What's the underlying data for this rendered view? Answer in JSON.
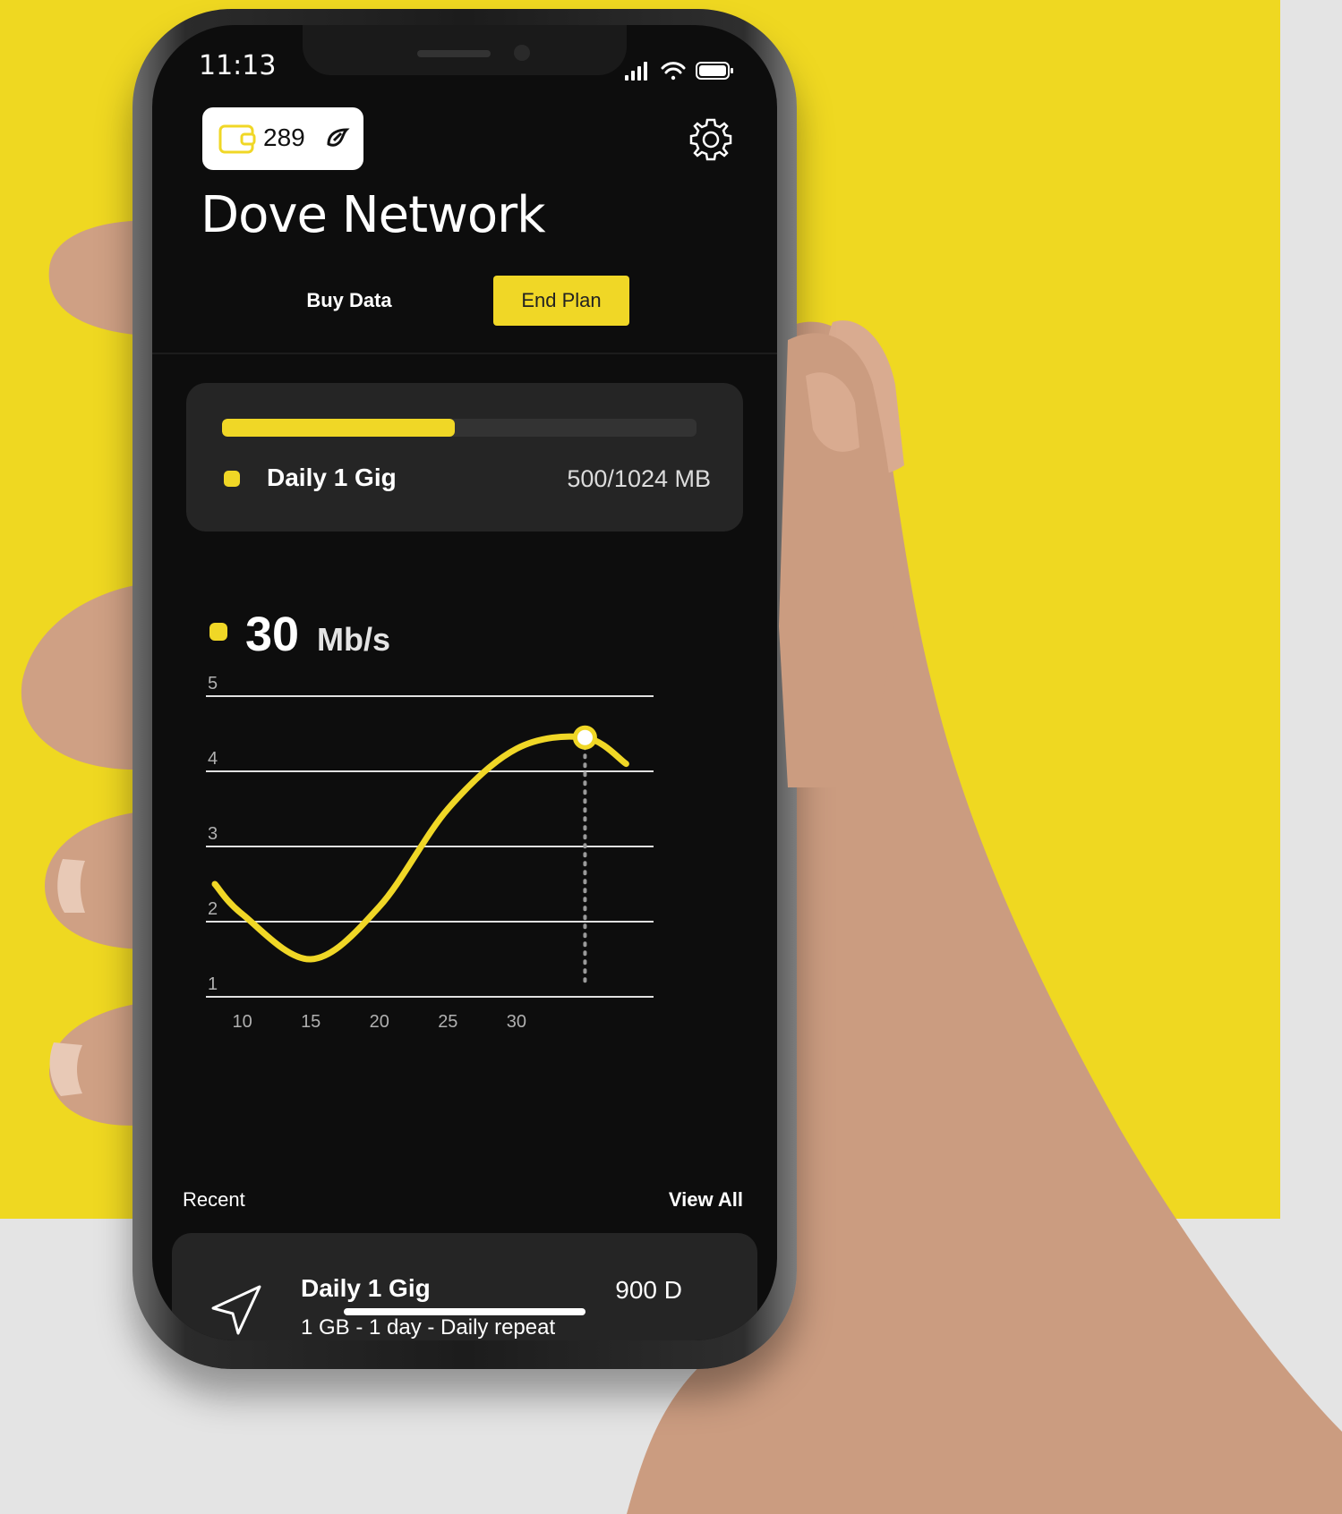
{
  "status_bar": {
    "time": "11:13"
  },
  "wallet": {
    "amount": "289",
    "icon": "wallet-icon",
    "currency_icon": "dove-currency-icon"
  },
  "settings": {
    "icon": "gear-icon"
  },
  "title": "Dove Network",
  "actions": {
    "buy_data": "Buy Data",
    "end_plan": "End Plan"
  },
  "plan": {
    "name": "Daily 1 Gig",
    "usage": "500/1024 MB",
    "progress": 0.49
  },
  "speed": {
    "value": "30",
    "unit": "Mb/s"
  },
  "chart_data": {
    "type": "line",
    "x_ticks": [
      "10",
      "15",
      "20",
      "25",
      "30"
    ],
    "y_ticks": [
      "1",
      "2",
      "3",
      "4",
      "5"
    ],
    "ylim": [
      1,
      5
    ],
    "xlim": [
      8,
      40
    ],
    "series": [
      {
        "x": [
          8,
          10,
          15,
          20,
          25,
          30,
          35,
          38
        ],
        "y": [
          2.5,
          2.1,
          1.5,
          2.2,
          3.5,
          4.3,
          4.45,
          4.1
        ]
      }
    ],
    "highlight": {
      "x": 35,
      "y": 4.45
    },
    "colors": {
      "line": "#f0d726",
      "grid": "#e0e0e0",
      "text": "#b0b0b0"
    }
  },
  "recent": {
    "label": "Recent",
    "view_all": "View All",
    "items": [
      {
        "title": "Daily 1 Gig",
        "subtitle": "1 GB - 1 day - Daily repeat",
        "price": "900 D",
        "icon": "send-icon"
      }
    ]
  }
}
